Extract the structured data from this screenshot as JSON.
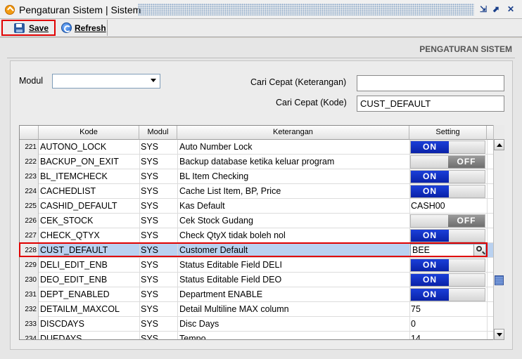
{
  "window": {
    "title": "Pengaturan Sistem | Sistem"
  },
  "toolbar": {
    "save_label": "Save",
    "refresh_label": "Refresh"
  },
  "section_title": "PENGATURAN SISTEM",
  "filters": {
    "modul_label": "Modul",
    "modul_value": "",
    "cari_ket_label": "Cari Cepat (Keterangan)",
    "cari_ket_value": "",
    "cari_kode_label": "Cari Cepat (Kode)",
    "cari_kode_value": "CUST_DEFAULT"
  },
  "grid": {
    "columns": {
      "kode": "Kode",
      "modul": "Modul",
      "keterangan": "Keterangan",
      "setting": "Setting"
    },
    "toggle": {
      "on": "ON",
      "off": "OFF"
    },
    "rows": [
      {
        "num": "221",
        "kode": "AUTONO_LOCK",
        "modul": "SYS",
        "ket": "Auto Number Lock",
        "type": "toggle",
        "state": "on"
      },
      {
        "num": "222",
        "kode": "BACKUP_ON_EXIT",
        "modul": "SYS",
        "ket": "Backup database ketika keluar program",
        "type": "toggle",
        "state": "off"
      },
      {
        "num": "223",
        "kode": "BL_ITEMCHECK",
        "modul": "SYS",
        "ket": "BL Item Checking",
        "type": "toggle",
        "state": "on"
      },
      {
        "num": "224",
        "kode": "CACHEDLIST",
        "modul": "SYS",
        "ket": "Cache List Item, BP, Price",
        "type": "toggle",
        "state": "on"
      },
      {
        "num": "225",
        "kode": "CASHID_DEFAULT",
        "modul": "SYS",
        "ket": "Kas Default",
        "type": "text",
        "value": "CASH00"
      },
      {
        "num": "226",
        "kode": "CEK_STOCK",
        "modul": "SYS",
        "ket": "Cek Stock Gudang",
        "type": "toggle",
        "state": "off"
      },
      {
        "num": "227",
        "kode": "CHECK_QTYX",
        "modul": "SYS",
        "ket": "Check QtyX tidak boleh nol",
        "type": "toggle",
        "state": "on"
      },
      {
        "num": "228",
        "kode": "CUST_DEFAULT",
        "modul": "SYS",
        "ket": "Customer Default",
        "type": "editor",
        "value": "BEE",
        "selected": true
      },
      {
        "num": "229",
        "kode": "DELI_EDIT_ENB",
        "modul": "SYS",
        "ket": "Status Editable Field DELI",
        "type": "toggle",
        "state": "on"
      },
      {
        "num": "230",
        "kode": "DEO_EDIT_ENB",
        "modul": "SYS",
        "ket": "Status Editable Field DEO",
        "type": "toggle",
        "state": "on"
      },
      {
        "num": "231",
        "kode": "DEPT_ENABLED",
        "modul": "SYS",
        "ket": "Department ENABLE",
        "type": "toggle",
        "state": "on"
      },
      {
        "num": "232",
        "kode": "DETAILM_MAXCOL",
        "modul": "SYS",
        "ket": "Detail Multiline MAX column",
        "type": "text",
        "value": "75"
      },
      {
        "num": "233",
        "kode": "DISCDAYS",
        "modul": "SYS",
        "ket": "Disc Days",
        "type": "text",
        "value": "0"
      },
      {
        "num": "234",
        "kode": "DUEDAYS",
        "modul": "SYS",
        "ket": "Tempo",
        "type": "text",
        "value": "14"
      }
    ]
  },
  "colors": {
    "accent_blue": "#0a22a8",
    "highlight_red": "#e00000",
    "selected_row": "#b9d1f0"
  }
}
